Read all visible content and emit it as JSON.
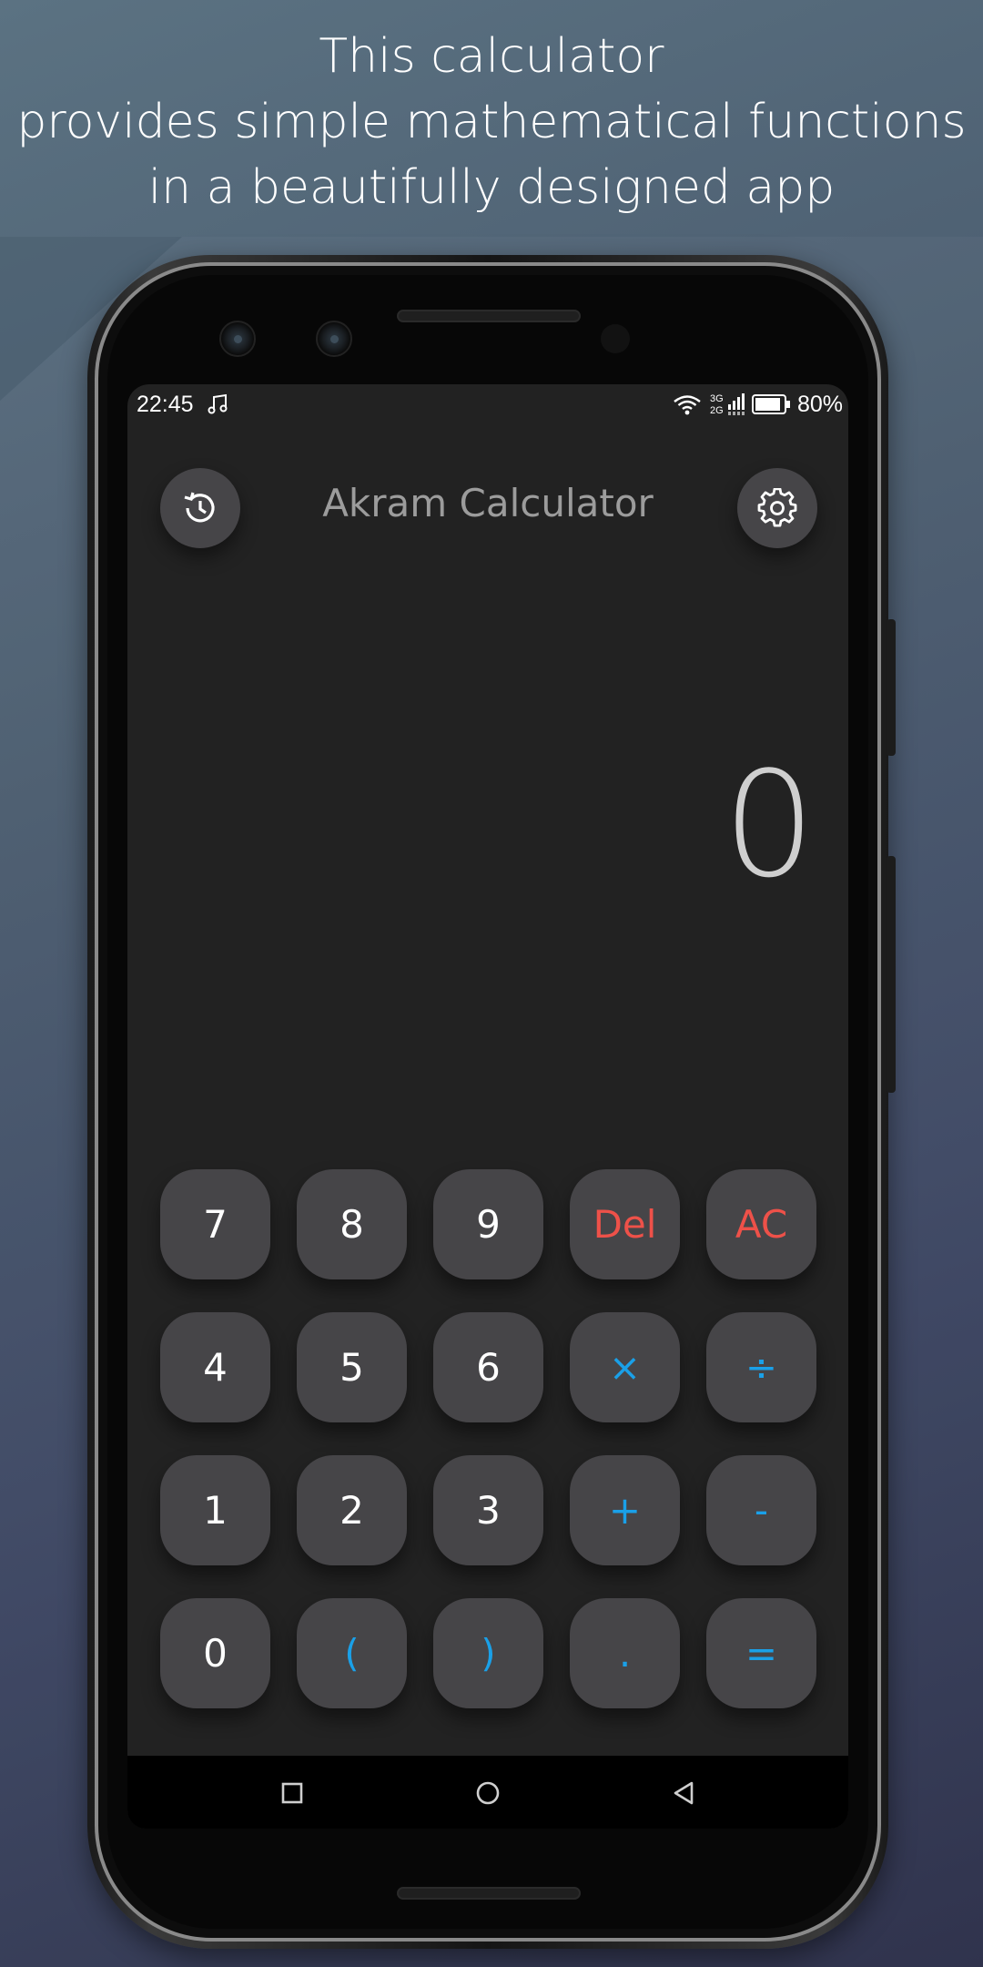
{
  "promo": {
    "line1": "This calculator",
    "line2": "provides simple mathematical functions",
    "line3": "in a beautifully designed app"
  },
  "status_bar": {
    "time": "22:45",
    "signal_top": "3G",
    "signal_bottom": "2G",
    "battery": "80%",
    "icons": [
      "music-note-icon",
      "wifi-icon",
      "signal-icon",
      "battery-icon"
    ]
  },
  "header": {
    "title": "Akram Calculator",
    "history_icon": "history-icon",
    "settings_icon": "gear-icon"
  },
  "display": {
    "value": "0"
  },
  "keypad": {
    "rows": [
      [
        {
          "label": "7",
          "type": "num"
        },
        {
          "label": "8",
          "type": "num"
        },
        {
          "label": "9",
          "type": "num"
        },
        {
          "label": "Del",
          "type": "red"
        },
        {
          "label": "AC",
          "type": "red"
        }
      ],
      [
        {
          "label": "4",
          "type": "num"
        },
        {
          "label": "5",
          "type": "num"
        },
        {
          "label": "6",
          "type": "num"
        },
        {
          "label": "×",
          "type": "blue"
        },
        {
          "label": "÷",
          "type": "blue"
        }
      ],
      [
        {
          "label": "1",
          "type": "num"
        },
        {
          "label": "2",
          "type": "num"
        },
        {
          "label": "3",
          "type": "num"
        },
        {
          "label": "+",
          "type": "blue"
        },
        {
          "label": "-",
          "type": "blue"
        }
      ],
      [
        {
          "label": "0",
          "type": "num"
        },
        {
          "label": "(",
          "type": "blue"
        },
        {
          "label": ")",
          "type": "blue"
        },
        {
          "label": ".",
          "type": "blue"
        },
        {
          "label": "=",
          "type": "blue"
        }
      ]
    ]
  },
  "navbar": {
    "icons": [
      "recents-square-icon",
      "home-circle-icon",
      "back-triangle-icon"
    ]
  },
  "colors": {
    "key_bg": "#464548",
    "screen_bg": "#222222",
    "operator_blue": "#1aa0e8",
    "delete_red": "#ee5149"
  }
}
